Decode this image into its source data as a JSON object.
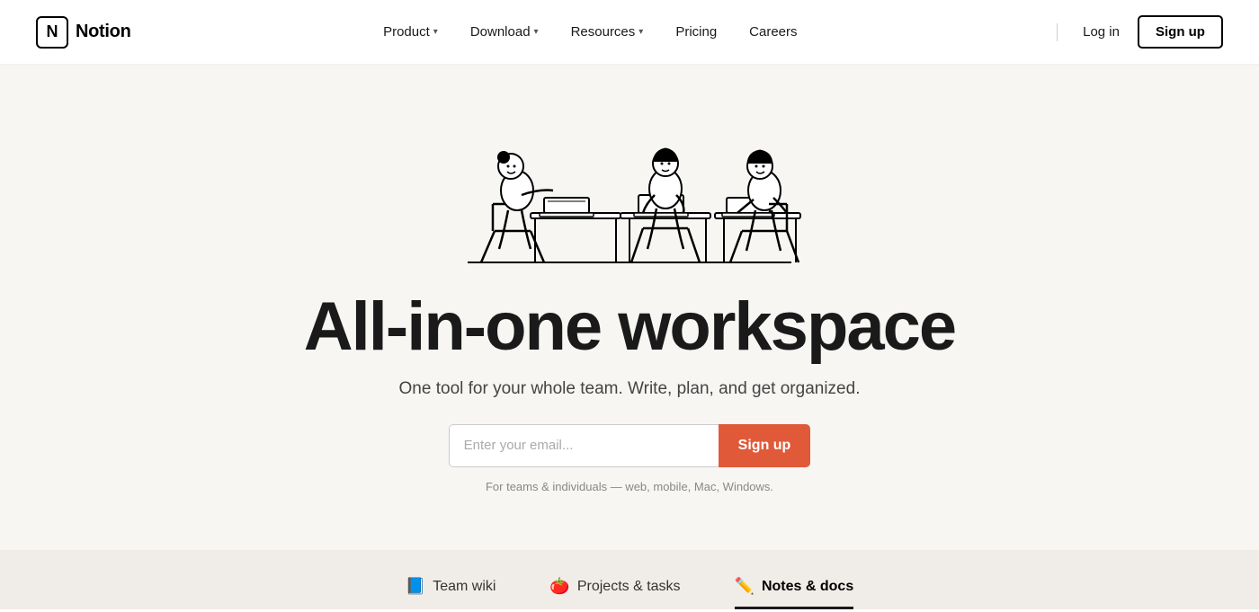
{
  "navbar": {
    "brand": {
      "logo_letter": "N",
      "wordmark": "Notion"
    },
    "nav_items": [
      {
        "label": "Product",
        "has_dropdown": true
      },
      {
        "label": "Download",
        "has_dropdown": true
      },
      {
        "label": "Resources",
        "has_dropdown": true
      },
      {
        "label": "Pricing",
        "has_dropdown": false
      },
      {
        "label": "Careers",
        "has_dropdown": false
      }
    ],
    "auth": {
      "login_label": "Log in",
      "signup_label": "Sign up"
    }
  },
  "hero": {
    "title": "All-in-one workspace",
    "subtitle": "One tool for your whole team. Write, plan, and get organized.",
    "email_placeholder": "Enter your email...",
    "cta_button": "Sign up",
    "note": "For teams & individuals — web, mobile, Mac, Windows."
  },
  "bottom_tabs": {
    "tabs": [
      {
        "label": "Team wiki",
        "emoji": "📘",
        "active": false
      },
      {
        "label": "Projects & tasks",
        "emoji": "🍅",
        "active": false
      },
      {
        "label": "Notes & docs",
        "emoji": "✏️",
        "active": true
      }
    ]
  },
  "illustration": {
    "description": "Three people working at desks with laptops"
  }
}
